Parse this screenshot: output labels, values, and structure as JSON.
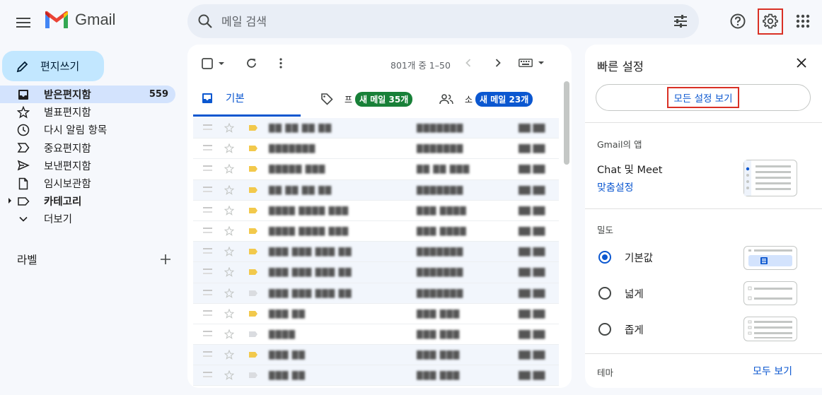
{
  "header": {
    "app_name": "Gmail",
    "search_placeholder": "메일 검색"
  },
  "sidebar": {
    "compose_label": "편지쓰기",
    "items": [
      {
        "label": "받은편지함",
        "count": "559"
      },
      {
        "label": "별표편지함"
      },
      {
        "label": "다시 알림 항목"
      },
      {
        "label": "중요편지함"
      },
      {
        "label": "보낸편지함"
      },
      {
        "label": "임시보관함"
      },
      {
        "label": "카테고리"
      },
      {
        "label": "더보기"
      }
    ],
    "labels_title": "라벨"
  },
  "mail": {
    "page_info": "801개 중 1–50",
    "tabs": [
      {
        "label": "기본"
      },
      {
        "label": "프",
        "badge": "새 메일 35개",
        "badge_color": "#188038"
      },
      {
        "label": "소",
        "badge": "새 메일 23개",
        "badge_color": "#0b57d0"
      }
    ],
    "rows": [
      {
        "sender": "██ ██ ██ ██",
        "subject": "███████",
        "date": "██ ██"
      },
      {
        "sender": "███████",
        "subject": "███████",
        "date": "██ ██"
      },
      {
        "sender": "█████ ███",
        "subject": "██ ██ ███",
        "date": "██ ██"
      },
      {
        "sender": "██ ██ ██ ██",
        "subject": "███████",
        "date": "██ ██"
      },
      {
        "sender": "████ ████ ███",
        "subject": "███ ████",
        "date": "██ ██"
      },
      {
        "sender": "████ ████ ███",
        "subject": "███ ████",
        "date": "██ ██"
      },
      {
        "sender": "███ ███ ███ ██",
        "subject": "███████",
        "date": "██ ██"
      },
      {
        "sender": "███ ███ ███ ██",
        "subject": "███████",
        "date": "██ ██"
      },
      {
        "sender": "███ ███ ███ ██",
        "subject": "███████",
        "date": "██ ██"
      },
      {
        "sender": "███ ██",
        "subject": "███ ███",
        "date": "██ ██"
      },
      {
        "sender": "████",
        "subject": "███ ███",
        "date": "██ ██"
      },
      {
        "sender": "███ ██",
        "subject": "███ ███",
        "date": "██ ██"
      },
      {
        "sender": "███ ██",
        "subject": "███ ███",
        "date": "██ ██"
      }
    ]
  },
  "quick_settings": {
    "title": "빠른 설정",
    "see_all": "모든 설정 보기",
    "apps_section": "Gmail의 앱",
    "chat_meet": "Chat 및 Meet",
    "customize": "맞춤설정",
    "density_section": "밀도",
    "density_options": [
      {
        "label": "기본값",
        "selected": true
      },
      {
        "label": "넓게",
        "selected": false
      },
      {
        "label": "좁게",
        "selected": false
      }
    ],
    "theme_section": "테마",
    "theme_see_all": "모두 보기"
  }
}
